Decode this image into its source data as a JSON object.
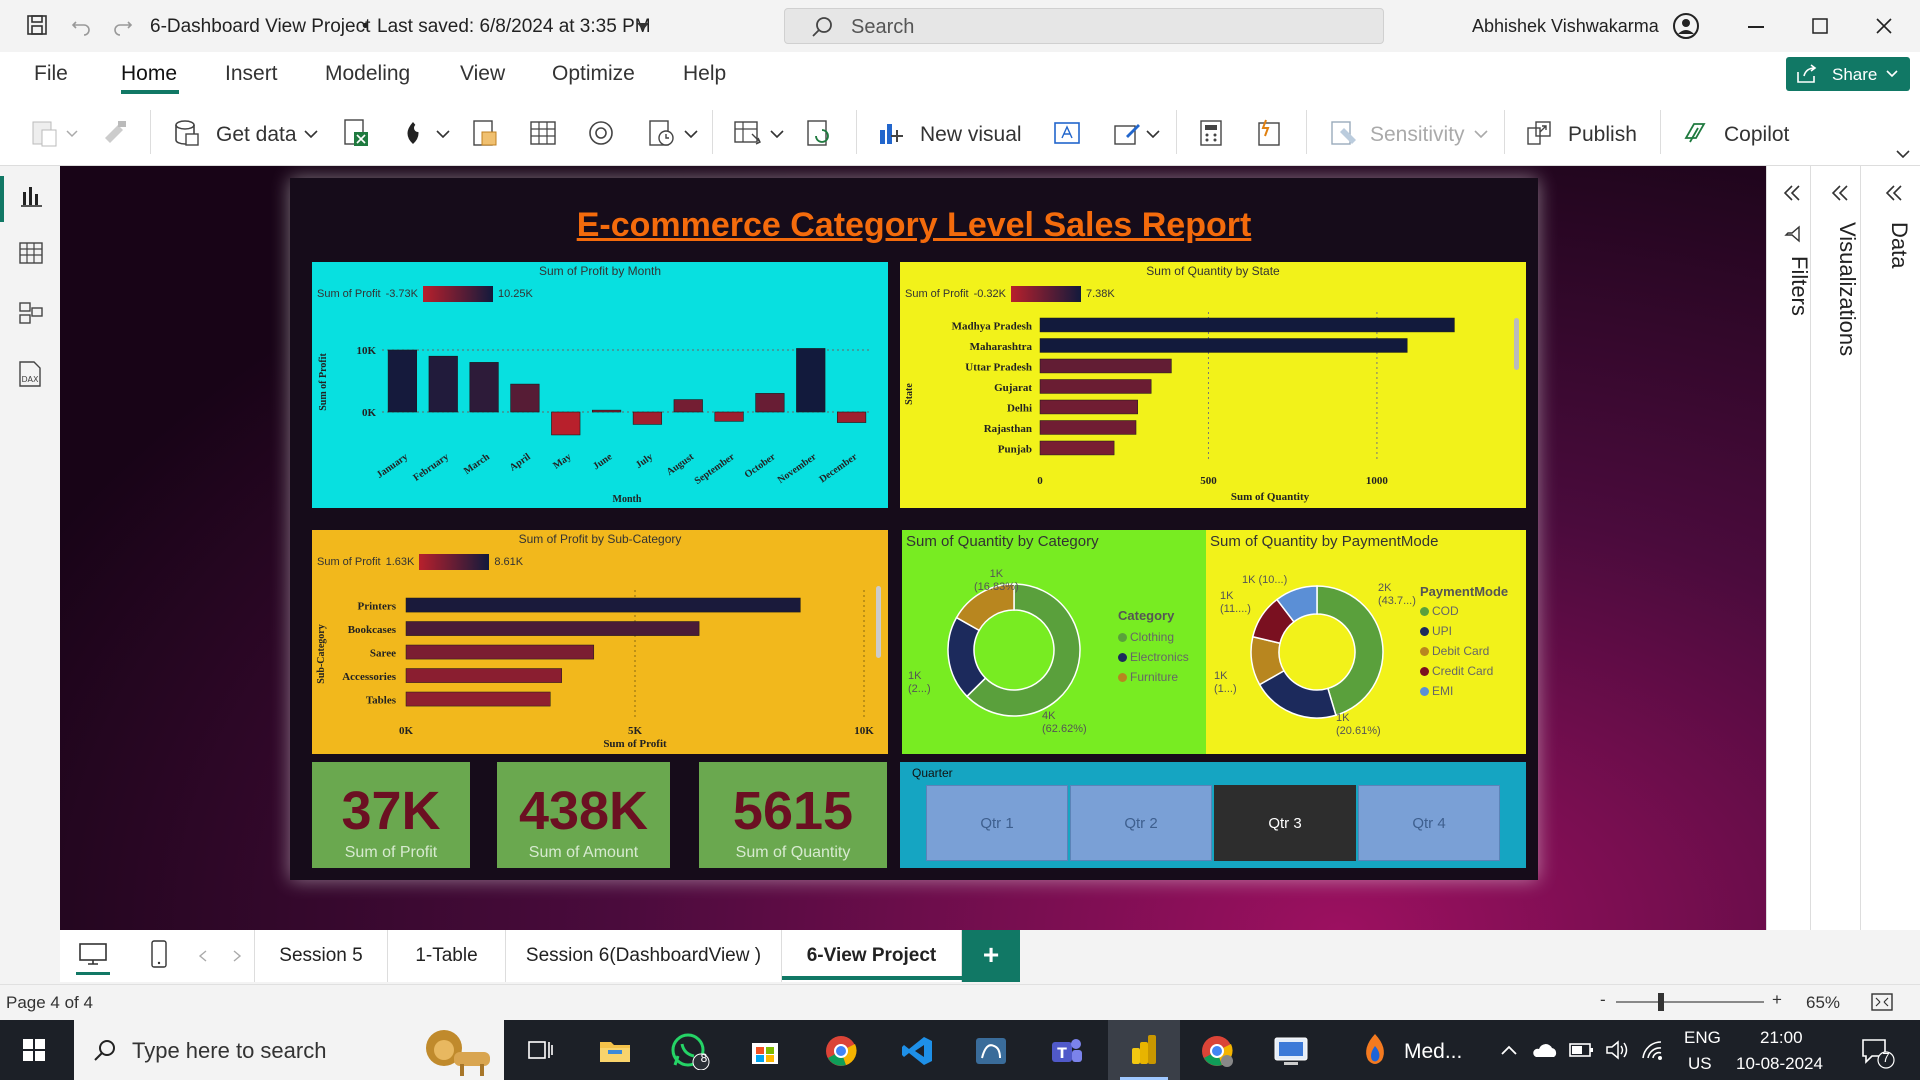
{
  "app": {
    "title": "6-Dashboard View Project",
    "saved": "Last saved: 6/8/2024 at 3:35 PM",
    "search_placeholder": "Search",
    "user": "Abhishek Vishwakarma",
    "share": "Share"
  },
  "menu": [
    "File",
    "Home",
    "Insert",
    "Modeling",
    "View",
    "Optimize",
    "Help"
  ],
  "ribbon": {
    "get_data": "Get data",
    "new_visual": "New visual",
    "sensitivity": "Sensitivity",
    "publish": "Publish",
    "copilot": "Copilot"
  },
  "panes": {
    "filters": "Filters",
    "visualizations": "Visualizations",
    "data": "Data"
  },
  "report_title": "E-commerce Category Level Sales Report",
  "profit_month": {
    "title": "Sum of Profit by Month",
    "legend_label": "Sum of Profit",
    "legend_min": "-3.73K",
    "legend_max": "10.25K",
    "ylabel": "Sum of Profit",
    "xlabel": "Month",
    "ticks": [
      "10K",
      "0K"
    ],
    "chart_data": {
      "type": "bar",
      "categories": [
        "January",
        "February",
        "March",
        "April",
        "May",
        "June",
        "July",
        "August",
        "September",
        "October",
        "November",
        "December"
      ],
      "values": [
        10000,
        9000,
        8000,
        4500,
        -3700,
        300,
        -2000,
        2000,
        -1500,
        3000,
        10250,
        -1700
      ],
      "ylim": [
        -3730,
        10250
      ]
    }
  },
  "qty_state": {
    "title": "Sum of Quantity by State",
    "legend_label": "Sum of Profit",
    "legend_min": "-0.32K",
    "legend_max": "7.38K",
    "ylabel": "State",
    "xlabel": "Sum of Quantity",
    "ticks": [
      "0",
      "500",
      "1000"
    ],
    "chart_data": {
      "type": "bar",
      "categories": [
        "Madhya Pradesh",
        "Maharashtra",
        "Uttar Pradesh",
        "Gujarat",
        "Delhi",
        "Rajasthan",
        "Punjab"
      ],
      "values": [
        1230,
        1090,
        390,
        330,
        290,
        285,
        220
      ],
      "xlim": [
        0,
        1300
      ]
    }
  },
  "profit_subcat": {
    "title": "Sum of Profit by Sub-Category",
    "legend_label": "Sum of Profit",
    "legend_min": "1.63K",
    "legend_max": "8.61K",
    "ylabel": "Sub-Category",
    "xlabel": "Sum of Profit",
    "ticks": [
      "0K",
      "5K",
      "10K"
    ],
    "chart_data": {
      "type": "bar",
      "categories": [
        "Printers",
        "Bookcases",
        "Saree",
        "Accessories",
        "Tables"
      ],
      "values": [
        8610,
        6400,
        4100,
        3400,
        3150
      ],
      "xlim": [
        0,
        10000
      ]
    }
  },
  "qty_category": {
    "title": "Sum of Quantity by Category",
    "legend_title": "Category",
    "labels": {
      "top": "1K",
      "top_pct": "(16.83%)",
      "left": "1K",
      "left_pct": "(2...)",
      "bottom": "4K",
      "bottom_pct": "(62.62%)"
    },
    "chart_data": {
      "type": "pie",
      "categories": [
        "Clothing",
        "Electronics",
        "Furniture"
      ],
      "values": [
        62.62,
        20.55,
        16.83
      ]
    },
    "colors": [
      "#5aa03c",
      "#1c2a5c",
      "#b8861f"
    ]
  },
  "qty_payment": {
    "title": "Sum of Quantity by PaymentMode",
    "legend_title": "PaymentMode",
    "labels": {
      "tl": "1K (10...)",
      "l1": "1K",
      "l1b": "(11....)",
      "l2": "1K",
      "l2b": "(1...)",
      "tr": "2K",
      "trb": "(43.7...)",
      "b": "1K",
      "bb": "(20.61%)"
    },
    "chart_data": {
      "type": "pie",
      "categories": [
        "COD",
        "UPI",
        "Debit Card",
        "Credit Card",
        "EMI"
      ],
      "values": [
        43.7,
        20.61,
        11.5,
        10.5,
        10.0
      ]
    },
    "colors": [
      "#5aa03c",
      "#1c2a5c",
      "#b8861f",
      "#7a1020",
      "#5b8fd6"
    ]
  },
  "kpis": [
    {
      "value": "37K",
      "label": "Sum of Profit"
    },
    {
      "value": "438K",
      "label": "Sum of Amount"
    },
    {
      "value": "5615",
      "label": "Sum of Quantity"
    }
  ],
  "quarter": {
    "title": "Quarter",
    "options": [
      "Qtr 1",
      "Qtr 2",
      "Qtr 3",
      "Qtr 4"
    ],
    "selected": "Qtr 3"
  },
  "tabs": [
    "Session 5",
    "1-Table",
    "Session 6(DashboardView )",
    "6-View Project"
  ],
  "active_tab": "6-View Project",
  "status": {
    "page": "Page 4 of 4",
    "zoom": "65%"
  },
  "taskbar": {
    "search": "Type here to search",
    "app_label": "Med...",
    "lang1": "ENG",
    "lang2": "US",
    "time": "21:00",
    "date": "10-08-2024",
    "whatsapp_badge": "8",
    "notif_badge": "7"
  }
}
